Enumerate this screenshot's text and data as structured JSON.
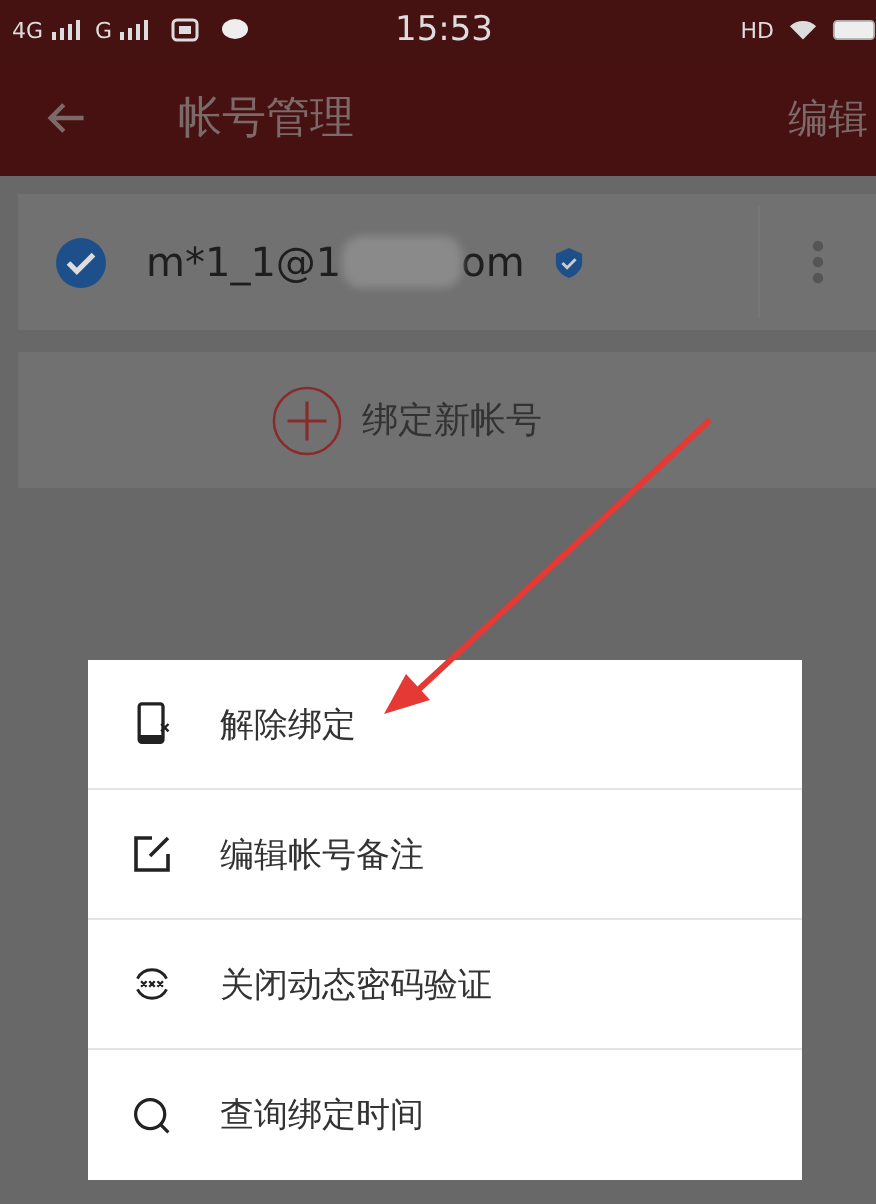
{
  "status_bar": {
    "left": [
      "4G",
      "G"
    ],
    "time": "15:53",
    "right": "HD"
  },
  "toolbar": {
    "title": "帐号管理",
    "action": "编辑"
  },
  "accounts": [
    {
      "email_start": "m*1_1@1",
      "email_end": "om",
      "selected": true,
      "verified": true
    }
  ],
  "add_account": {
    "label": "绑定新帐号"
  },
  "menu": {
    "items": [
      {
        "label": "解除绑定"
      },
      {
        "label": "编辑帐号备注"
      },
      {
        "label": "关闭动态密码验证"
      },
      {
        "label": "查询绑定时间"
      }
    ]
  }
}
